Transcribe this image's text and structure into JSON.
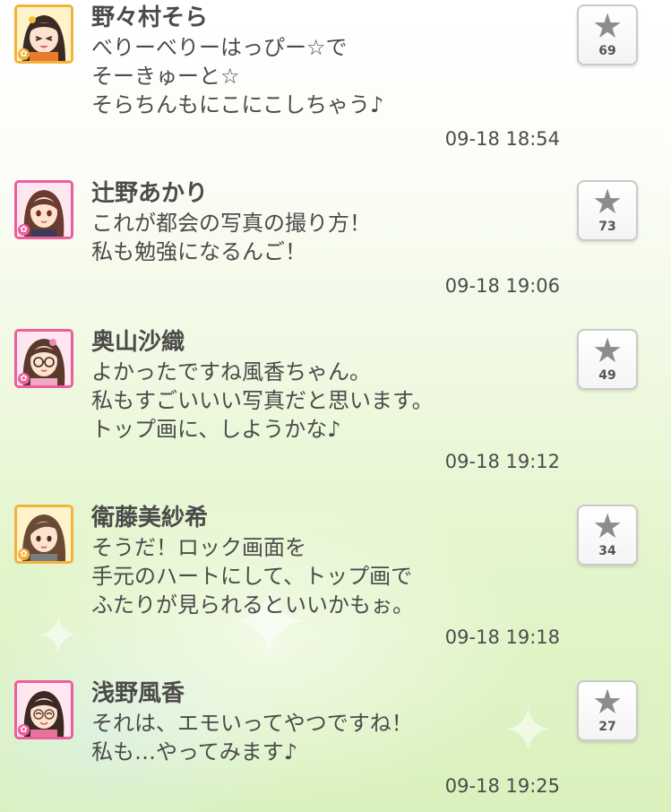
{
  "posts": [
    {
      "name": "野々村そら",
      "lines": [
        "べりーべりーはっぴー☆で",
        "そーきゅーと☆",
        "そらちんもにこにこしちゃう♪"
      ],
      "time": "09-18 18:54",
      "likes": "69",
      "frame": "gold"
    },
    {
      "name": "辻野あかり",
      "lines": [
        "これが都会の写真の撮り方！",
        "私も勉強になるんご！"
      ],
      "time": "09-18 19:06",
      "likes": "73",
      "frame": "pink"
    },
    {
      "name": "奥山沙織",
      "lines": [
        "よかったですね風香ちゃん。",
        "私もすごいいい写真だと思います。",
        "トップ画に、しようかな♪"
      ],
      "time": "09-18 19:12",
      "likes": "49",
      "frame": "pink"
    },
    {
      "name": "衛藤美紗希",
      "lines": [
        "そうだ！ロック画面を",
        "手元のハートにして、トップ画で",
        "ふたりが見られるといいかもぉ。"
      ],
      "time": "09-18 19:18",
      "likes": "34",
      "frame": "gold"
    },
    {
      "name": "浅野風香",
      "lines": [
        "それは、エモいってやつですね！",
        "私も…やってみます♪"
      ],
      "time": "09-18 19:25",
      "likes": "27",
      "frame": "pink"
    }
  ],
  "icons": {
    "like": "star-icon",
    "frame_badge": "flower-icon"
  },
  "colors": {
    "gold_frame": "#f2b33d",
    "pink_frame": "#ec5f9d",
    "star_gray": "#8c8c8c"
  }
}
